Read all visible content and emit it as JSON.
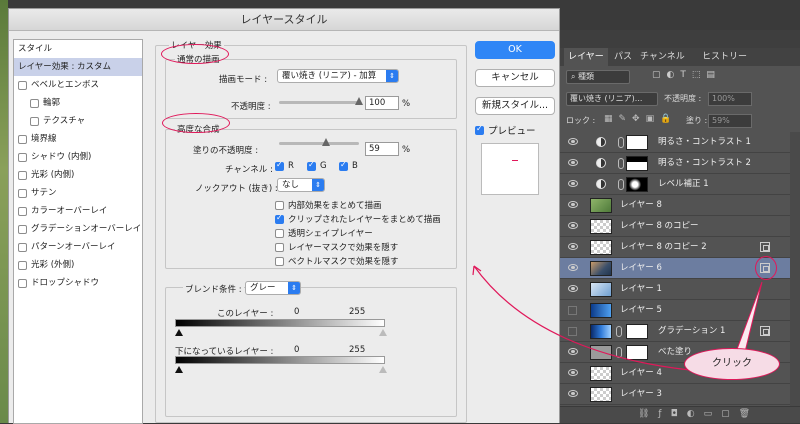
{
  "dialog": {
    "title": "レイヤースタイル",
    "styles_list": [
      {
        "label": "スタイル",
        "check": false,
        "indent": 0,
        "selected": false
      },
      {
        "label": "レイヤー効果 : カスタム",
        "check": false,
        "indent": 0,
        "selected": true
      },
      {
        "label": "ベベルとエンボス",
        "check": true,
        "indent": 0,
        "selected": false
      },
      {
        "label": "輪郭",
        "check": true,
        "indent": 1,
        "selected": false
      },
      {
        "label": "テクスチャ",
        "check": true,
        "indent": 1,
        "selected": false
      },
      {
        "label": "境界線",
        "check": true,
        "indent": 0,
        "selected": false
      },
      {
        "label": "シャドウ (内側)",
        "check": true,
        "indent": 0,
        "selected": false
      },
      {
        "label": "光彩 (内側)",
        "check": true,
        "indent": 0,
        "selected": false
      },
      {
        "label": "サテン",
        "check": true,
        "indent": 0,
        "selected": false
      },
      {
        "label": "カラーオーバーレイ",
        "check": true,
        "indent": 0,
        "selected": false
      },
      {
        "label": "グラデーションオーバーレイ",
        "check": true,
        "indent": 0,
        "selected": false
      },
      {
        "label": "パターンオーバーレイ",
        "check": true,
        "indent": 0,
        "selected": false
      },
      {
        "label": "光彩 (外側)",
        "check": true,
        "indent": 0,
        "selected": false
      },
      {
        "label": "ドロップシャドウ",
        "check": true,
        "indent": 0,
        "selected": false
      }
    ],
    "effects_group": "レイヤー効果",
    "normal_blend": {
      "title": "通常の描画",
      "mode_label": "描画モード :",
      "mode_value": "覆い焼き (リニア) - 加算",
      "opacity_label": "不透明度 :",
      "opacity_value": "100",
      "opacity_unit": "%",
      "opacity_level": 1.0
    },
    "advanced_blend": {
      "title": "高度な合成",
      "fill_label": "塗りの不透明度 :",
      "fill_value": "59",
      "fill_unit": "%",
      "fill_level": 0.59,
      "channels_label": "チャンネル :",
      "channels": [
        {
          "name": "R",
          "on": true
        },
        {
          "name": "G",
          "on": true
        },
        {
          "name": "B",
          "on": true
        }
      ],
      "knockout_label": "ノックアウト (抜き) :",
      "knockout_value": "なし",
      "options": [
        {
          "label": "内部効果をまとめて描画",
          "on": false
        },
        {
          "label": "クリップされたレイヤーをまとめて描画",
          "on": true
        },
        {
          "label": "透明シェイプレイヤー",
          "on": false
        },
        {
          "label": "レイヤーマスクで効果を隠す",
          "on": false
        },
        {
          "label": "ベクトルマスクで効果を隠す",
          "on": false
        }
      ]
    },
    "blend_if": {
      "label": "ブレンド条件 :",
      "value": "グレー",
      "this_layer_label": "このレイヤー :",
      "this_min": "0",
      "this_max": "255",
      "under_layer_label": "下になっているレイヤー :",
      "under_min": "0",
      "under_max": "255"
    },
    "buttons": {
      "ok": "OK",
      "cancel": "キャンセル",
      "new_style": "新規スタイル...",
      "preview": "プレビュー"
    },
    "preview_checked": true
  },
  "layers_panel": {
    "tabs": [
      "レイヤー",
      "パス",
      "チャンネル",
      "ヒストリー"
    ],
    "filter_label": "種類",
    "blend_mode": "覆い焼き (リニア)...",
    "opacity_label": "不透明度 :",
    "opacity_value": "100%",
    "lock_label": "ロック :",
    "fill_label": "塗り :",
    "fill_value": "59%",
    "layers": [
      {
        "name": "明るさ・コントラスト 1",
        "kind": "adjust",
        "eye": true,
        "selected": false,
        "clip": false
      },
      {
        "name": "明るさ・コントラスト 2",
        "kind": "adjust",
        "eye": true,
        "selected": false,
        "clip": false
      },
      {
        "name": "レベル補正 1",
        "kind": "adjust",
        "eye": true,
        "selected": false,
        "clip": false
      },
      {
        "name": "レイヤー 8",
        "kind": "image-green",
        "eye": true,
        "selected": false,
        "clip": false
      },
      {
        "name": "レイヤー 8 のコピー",
        "kind": "checker",
        "eye": true,
        "selected": false,
        "clip": false
      },
      {
        "name": "レイヤー 8 のコピー 2",
        "kind": "checker",
        "eye": true,
        "selected": false,
        "clip": true
      },
      {
        "name": "レイヤー 6",
        "kind": "image-photo",
        "eye": true,
        "selected": true,
        "clip": true
      },
      {
        "name": "レイヤー 1",
        "kind": "image-blue",
        "eye": true,
        "selected": false,
        "clip": false
      },
      {
        "name": "レイヤー 5",
        "kind": "image-bluebar",
        "eye": false,
        "selected": false,
        "clip": false
      },
      {
        "name": "グラデーション 1",
        "kind": "gradient",
        "eye": false,
        "selected": false,
        "clip": true
      },
      {
        "name": "べた塗り",
        "kind": "fill",
        "eye": true,
        "selected": false,
        "clip": false
      },
      {
        "name": "レイヤー 4",
        "kind": "checker",
        "eye": true,
        "selected": false,
        "clip": false
      },
      {
        "name": "レイヤー 3",
        "kind": "checker",
        "eye": true,
        "selected": false,
        "clip": false
      }
    ]
  },
  "annotation": {
    "callout_text": "クリック",
    "accent_color": "#e0185a"
  },
  "colors": {
    "accent": "#2f86f6",
    "panel_bg": "#535353",
    "selected_layer": "#6c7da0"
  }
}
